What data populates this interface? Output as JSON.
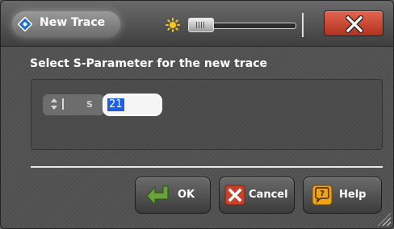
{
  "window": {
    "title": "New Trace",
    "logo_icon": "app-logo-icon",
    "brightness_icon": "sun-icon",
    "close_icon": "close-x-icon"
  },
  "prompt": "Select S-Parameter for the new trace",
  "parameter": {
    "prefix": "S",
    "value": "21",
    "spinner_icon": "spin-arrows-icon"
  },
  "buttons": {
    "ok": "OK",
    "cancel": "Cancel",
    "help": "Help"
  },
  "colors": {
    "close": "#c8412b",
    "selection": "#1d5fe0",
    "ok_icon": "#6aa33a",
    "help_icon": "#f0a21a"
  }
}
